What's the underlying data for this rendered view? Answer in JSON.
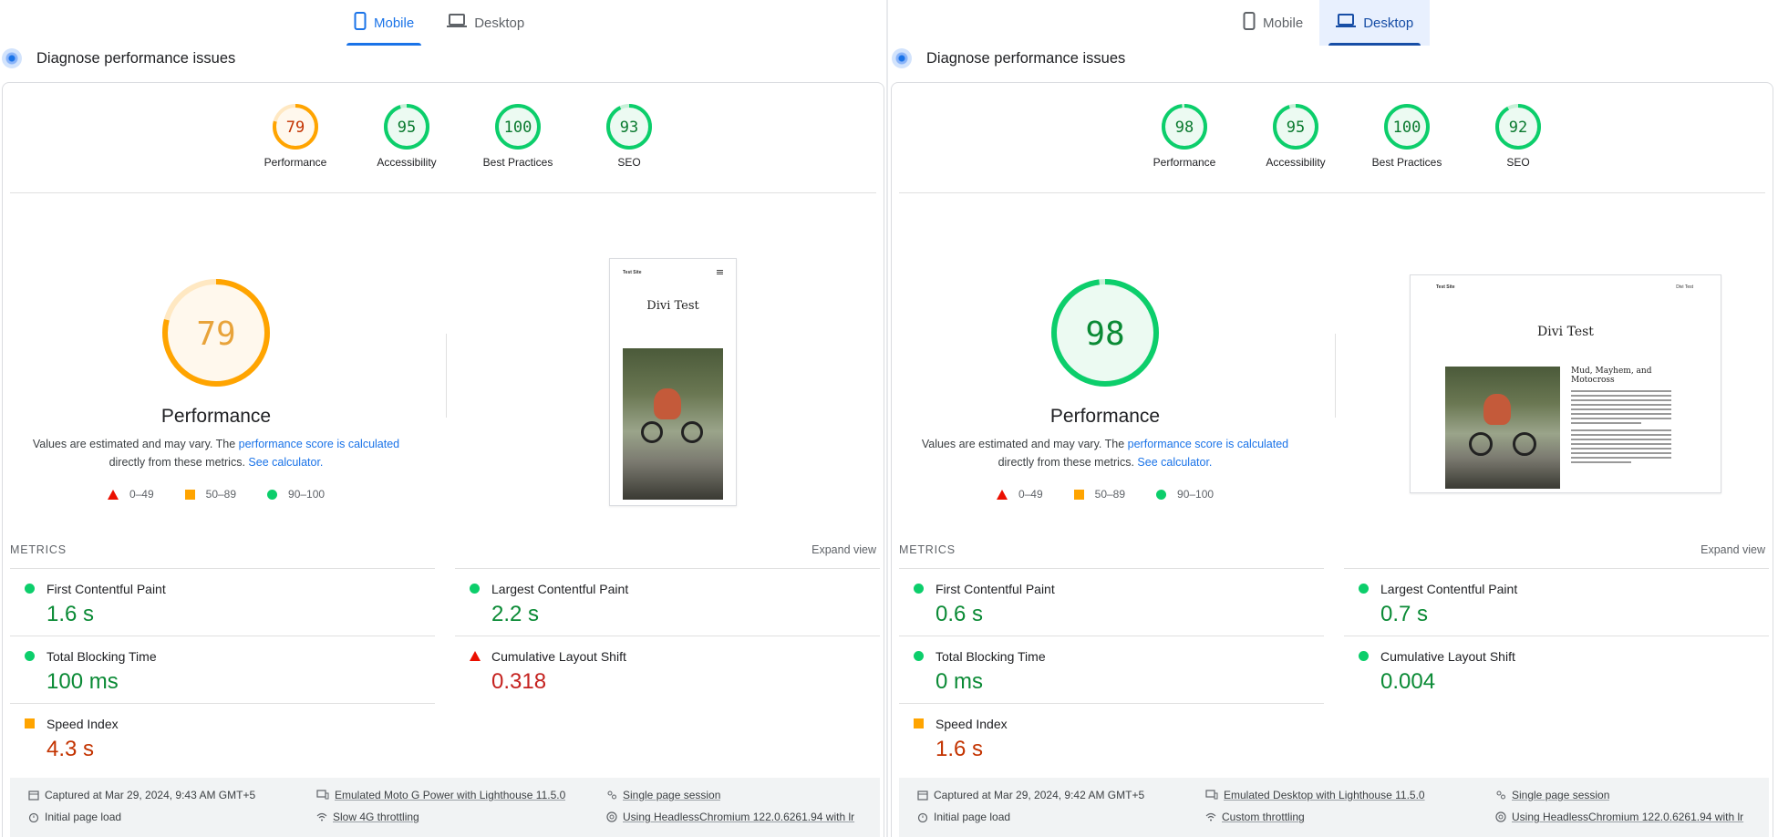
{
  "legend": {
    "low": "0–49",
    "mid": "50–89",
    "high": "90–100"
  },
  "colors": {
    "pass": "#0cce6b",
    "average": "#ffa400",
    "fail": "#eb0f00",
    "accent": "#1a73e8"
  },
  "panels": [
    {
      "tabs": {
        "mobile": "Mobile",
        "desktop": "Desktop",
        "active": "mobile"
      },
      "header": "Diagnose performance issues",
      "gauges": [
        {
          "score": "79",
          "label": "Performance"
        },
        {
          "score": "95",
          "label": "Accessibility"
        },
        {
          "score": "100",
          "label": "Best Practices"
        },
        {
          "score": "93",
          "label": "SEO"
        }
      ],
      "main": {
        "score": "79",
        "title": "Performance",
        "desc_pre": "Values are estimated and may vary. The ",
        "desc_link": "performance score is calculated",
        "desc_mid": "directly from these metrics.",
        "desc_link2": "See calculator."
      },
      "screenshot": {
        "site_name": "Test Site",
        "site_title": "Divi Test",
        "menu_icon": "hamburger-icon"
      },
      "metrics_label": "METRICS",
      "expand_label": "Expand view",
      "metrics": [
        {
          "name": "First Contentful Paint",
          "value": "1.6 s",
          "status": "pass"
        },
        {
          "name": "Largest Contentful Paint",
          "value": "2.2 s",
          "status": "pass"
        },
        {
          "name": "Total Blocking Time",
          "value": "100 ms",
          "status": "pass"
        },
        {
          "name": "Cumulative Layout Shift",
          "value": "0.318",
          "status": "fail"
        },
        {
          "name": "Speed Index",
          "value": "4.3 s",
          "status": "average"
        }
      ],
      "footer": {
        "captured": "Captured at Mar 29, 2024, 9:43 AM GMT+5",
        "initial": "Initial page load",
        "emulated": "Emulated Moto G Power with Lighthouse 11.5.0",
        "throttling": "Slow 4G throttling",
        "session": "Single page session",
        "browser": "Using HeadlessChromium 122.0.6261.94 with lr"
      }
    },
    {
      "tabs": {
        "mobile": "Mobile",
        "desktop": "Desktop",
        "active": "desktop"
      },
      "header": "Diagnose performance issues",
      "gauges": [
        {
          "score": "98",
          "label": "Performance"
        },
        {
          "score": "95",
          "label": "Accessibility"
        },
        {
          "score": "100",
          "label": "Best Practices"
        },
        {
          "score": "92",
          "label": "SEO"
        }
      ],
      "main": {
        "score": "98",
        "title": "Performance",
        "desc_pre": "Values are estimated and may vary. The ",
        "desc_link": "performance score is calculated",
        "desc_mid": "directly from these metrics.",
        "desc_link2": "See calculator."
      },
      "screenshot": {
        "site_name": "Test Site",
        "nav_link": "Divi Test",
        "site_title": "Divi Test",
        "article_title": "Mud, Mayhem, and Motocross"
      },
      "metrics_label": "METRICS",
      "expand_label": "Expand view",
      "metrics": [
        {
          "name": "First Contentful Paint",
          "value": "0.6 s",
          "status": "pass"
        },
        {
          "name": "Largest Contentful Paint",
          "value": "0.7 s",
          "status": "pass"
        },
        {
          "name": "Total Blocking Time",
          "value": "0 ms",
          "status": "pass"
        },
        {
          "name": "Cumulative Layout Shift",
          "value": "0.004",
          "status": "pass"
        },
        {
          "name": "Speed Index",
          "value": "1.6 s",
          "status": "average"
        }
      ],
      "footer": {
        "captured": "Captured at Mar 29, 2024, 9:42 AM GMT+5",
        "initial": "Initial page load",
        "emulated": "Emulated Desktop with Lighthouse 11.5.0",
        "throttling": "Custom throttling",
        "session": "Single page session",
        "browser": "Using HeadlessChromium 122.0.6261.94 with lr"
      }
    }
  ]
}
